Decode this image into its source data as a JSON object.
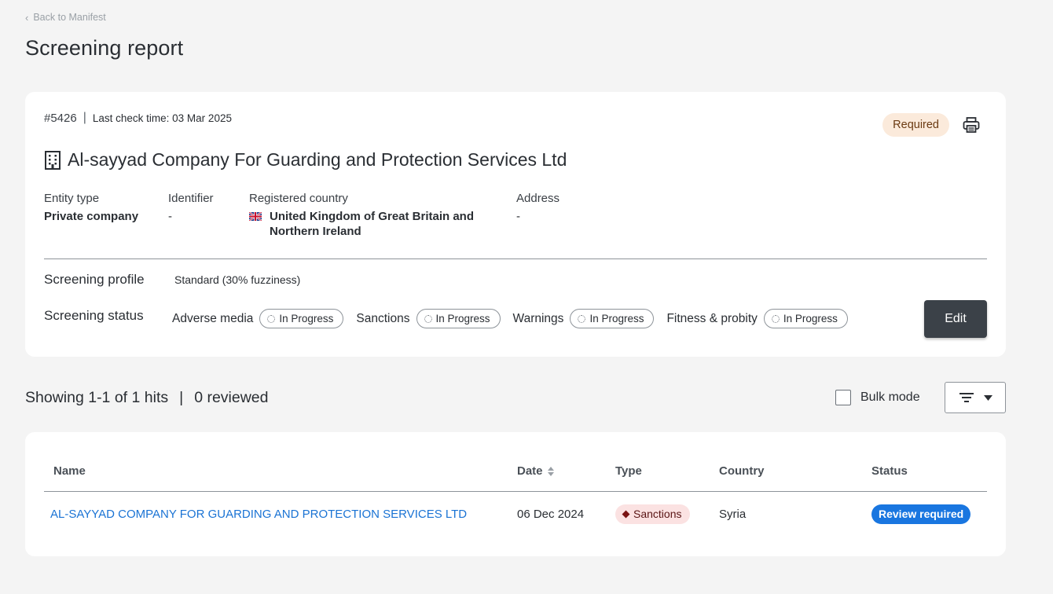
{
  "back_link": "Back to Manifest",
  "page_title": "Screening report",
  "report": {
    "case_id": "#5426",
    "last_check": "Last check time: 03 Mar 2025",
    "status_badge": "Required",
    "entity_name": "Al-sayyad Company For Guarding and Protection Services Ltd",
    "fields": {
      "entity_type": {
        "label": "Entity type",
        "value": "Private company"
      },
      "identifier": {
        "label": "Identifier",
        "value": "-"
      },
      "registered_country": {
        "label": "Registered country",
        "value_line1": "United Kingdom of Great Britain and",
        "value_line2": "Northern Ireland",
        "flag_icon": "uk-flag-icon"
      },
      "address": {
        "label": "Address",
        "value": "-"
      }
    },
    "screening_profile_label": "Screening profile",
    "screening_profile_value": "Standard (30% fuzziness)",
    "screening_status_label": "Screening status",
    "statuses": [
      {
        "name": "Adverse media",
        "state": "In Progress"
      },
      {
        "name": "Sanctions",
        "state": "In Progress"
      },
      {
        "name": "Warnings",
        "state": "In Progress"
      },
      {
        "name": "Fitness & probity",
        "state": "In Progress"
      }
    ],
    "edit_label": "Edit"
  },
  "hits": {
    "showing": "Showing 1-1 of 1 hits",
    "separator": "|",
    "reviewed": "0 reviewed",
    "bulk_mode_label": "Bulk mode"
  },
  "table": {
    "columns": [
      "Name",
      "Date",
      "Type",
      "Country",
      "Status"
    ],
    "rows": [
      {
        "name": "AL-SAYYAD COMPANY FOR GUARDING AND PROTECTION SERVICES LTD",
        "date": "06 Dec 2024",
        "type": "Sanctions",
        "country": "Syria",
        "status": "Review required"
      }
    ]
  },
  "colors": {
    "background": "#f4f4f4",
    "card": "#ffffff",
    "required_badge_bg": "#fbeadb",
    "edit_button_bg": "#3b4148",
    "link": "#1a73d4",
    "sanctions_badge_bg": "#fbe2e2",
    "review_badge_bg": "#1976e0"
  }
}
